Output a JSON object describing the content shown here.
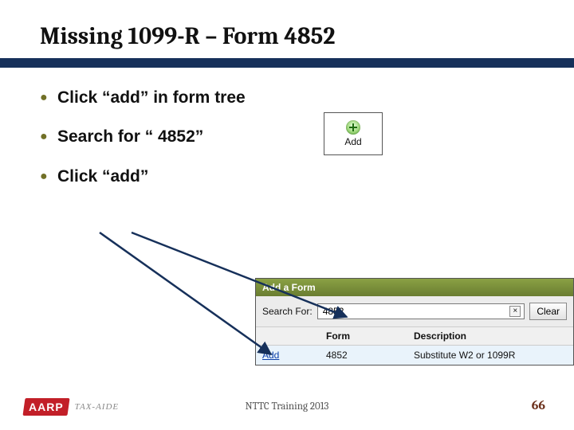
{
  "title": "Missing 1099-R – Form 4852",
  "bullets": {
    "b1": "Click “add” in form tree",
    "b2": "Search for “ 4852”",
    "b3": "Click “add”"
  },
  "add_button": {
    "label": "Add"
  },
  "dialog": {
    "title": "Add a Form",
    "search_label": "Search For:",
    "search_value": "4852",
    "clear_x": "×",
    "clear_button": "Clear",
    "columns": {
      "c0": "",
      "c1": "Form",
      "c2": "Description"
    },
    "row": {
      "add_link": "Add",
      "form": "4852",
      "desc": "Substitute W2 or 1099R"
    }
  },
  "footer": {
    "logo_text": "AARP",
    "logo_sub": "TAX-AIDE",
    "center": "NTTC Training 2013",
    "slide_number": "66"
  }
}
